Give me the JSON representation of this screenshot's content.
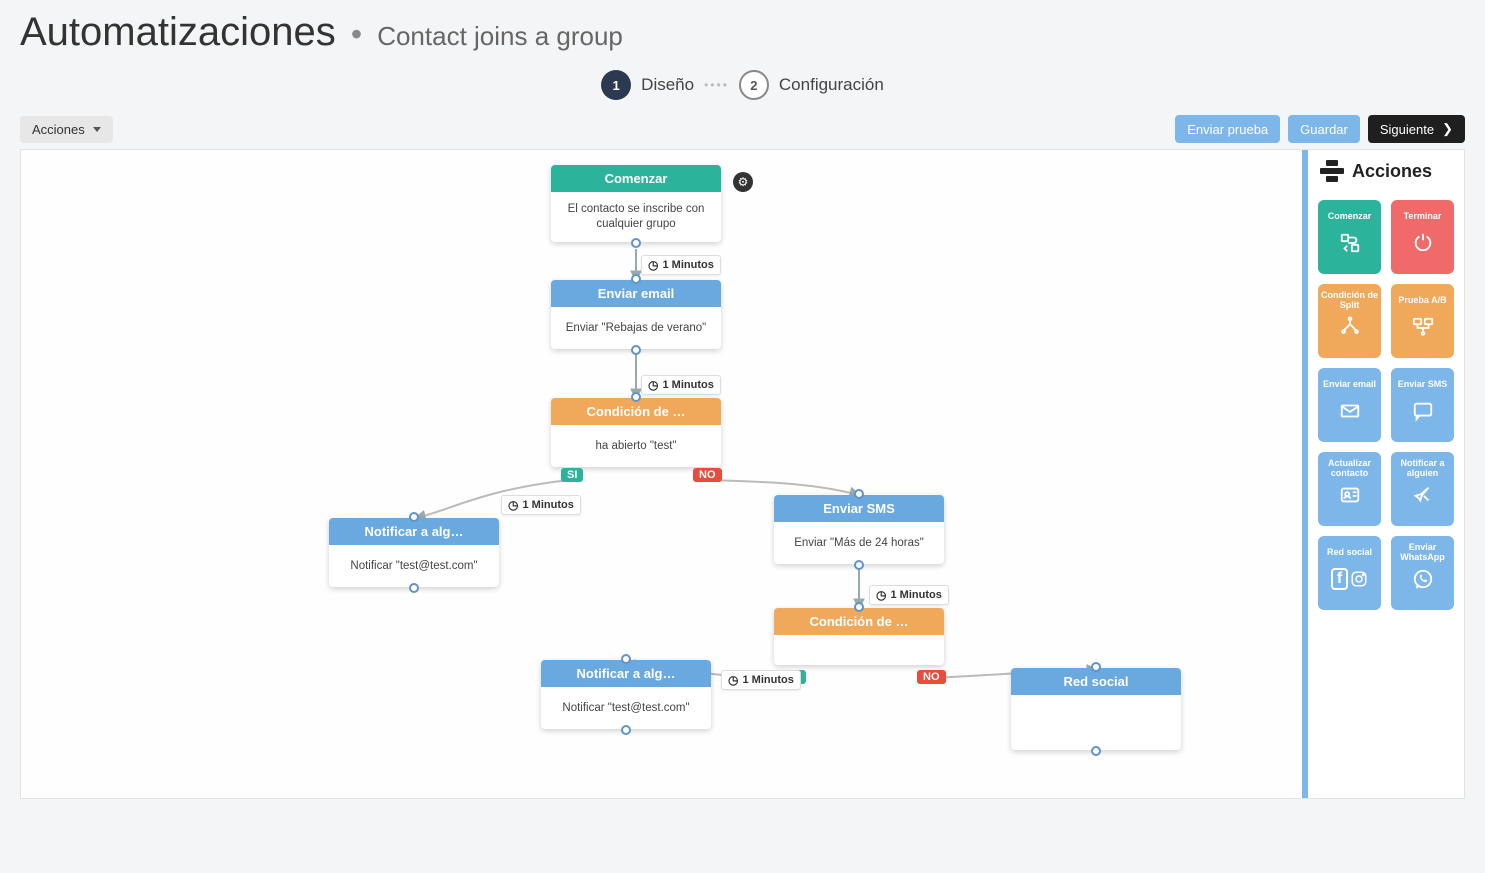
{
  "header": {
    "title": "Automatizaciones",
    "subtitle": "Contact joins a group"
  },
  "stepper": {
    "step1_num": "1",
    "step1_label": "Diseño",
    "step2_num": "2",
    "step2_label": "Configuración"
  },
  "toolbar": {
    "left_dropdown": "Acciones",
    "send_test": "Enviar prueba",
    "save": "Guardar",
    "next": "Siguiente"
  },
  "sidebar": {
    "title": "Acciones",
    "tiles": [
      {
        "label": "Comenzar",
        "color": "green",
        "icon": "start"
      },
      {
        "label": "Terminar",
        "color": "red",
        "icon": "stop"
      },
      {
        "label": "Condición de Split",
        "color": "orange",
        "icon": "split"
      },
      {
        "label": "Prueba A/B",
        "color": "orange",
        "icon": "ab"
      },
      {
        "label": "Enviar email",
        "color": "blue",
        "icon": "mail"
      },
      {
        "label": "Enviar SMS",
        "color": "blue",
        "icon": "sms"
      },
      {
        "label": "Actualizar contacto",
        "color": "blue",
        "icon": "contact"
      },
      {
        "label": "Notificar a alguien",
        "color": "blue",
        "icon": "notify"
      },
      {
        "label": "Red social",
        "color": "blue",
        "icon": "social"
      },
      {
        "label": "Enviar WhatsApp",
        "color": "blue",
        "icon": "whatsapp"
      }
    ]
  },
  "nodes": {
    "start": {
      "title": "Comenzar",
      "body": "El contacto se inscribe con cualquier grupo"
    },
    "email": {
      "title": "Enviar email",
      "body": "Enviar \"Rebajas de verano\""
    },
    "cond1": {
      "title": "Condición de …",
      "body": "ha abierto \"test\"",
      "si": "SI",
      "no": "NO"
    },
    "notify1": {
      "title": "Notificar a alg…",
      "body": "Notificar \"test@test.com\""
    },
    "sms": {
      "title": "Enviar SMS",
      "body": "Enviar \"Más de 24 horas\""
    },
    "cond2": {
      "title": "Condición de …",
      "body": "",
      "si": "SI",
      "no": "NO"
    },
    "notify2": {
      "title": "Notificar a alg…",
      "body": "Notificar \"test@test.com\""
    },
    "social": {
      "title": "Red social",
      "body": ""
    }
  },
  "delays": {
    "d1": "1 Minutos",
    "d2": "1 Minutos",
    "d3": "1 Minutos",
    "d4": "1 Minutos",
    "d5": "1 Minutos"
  }
}
